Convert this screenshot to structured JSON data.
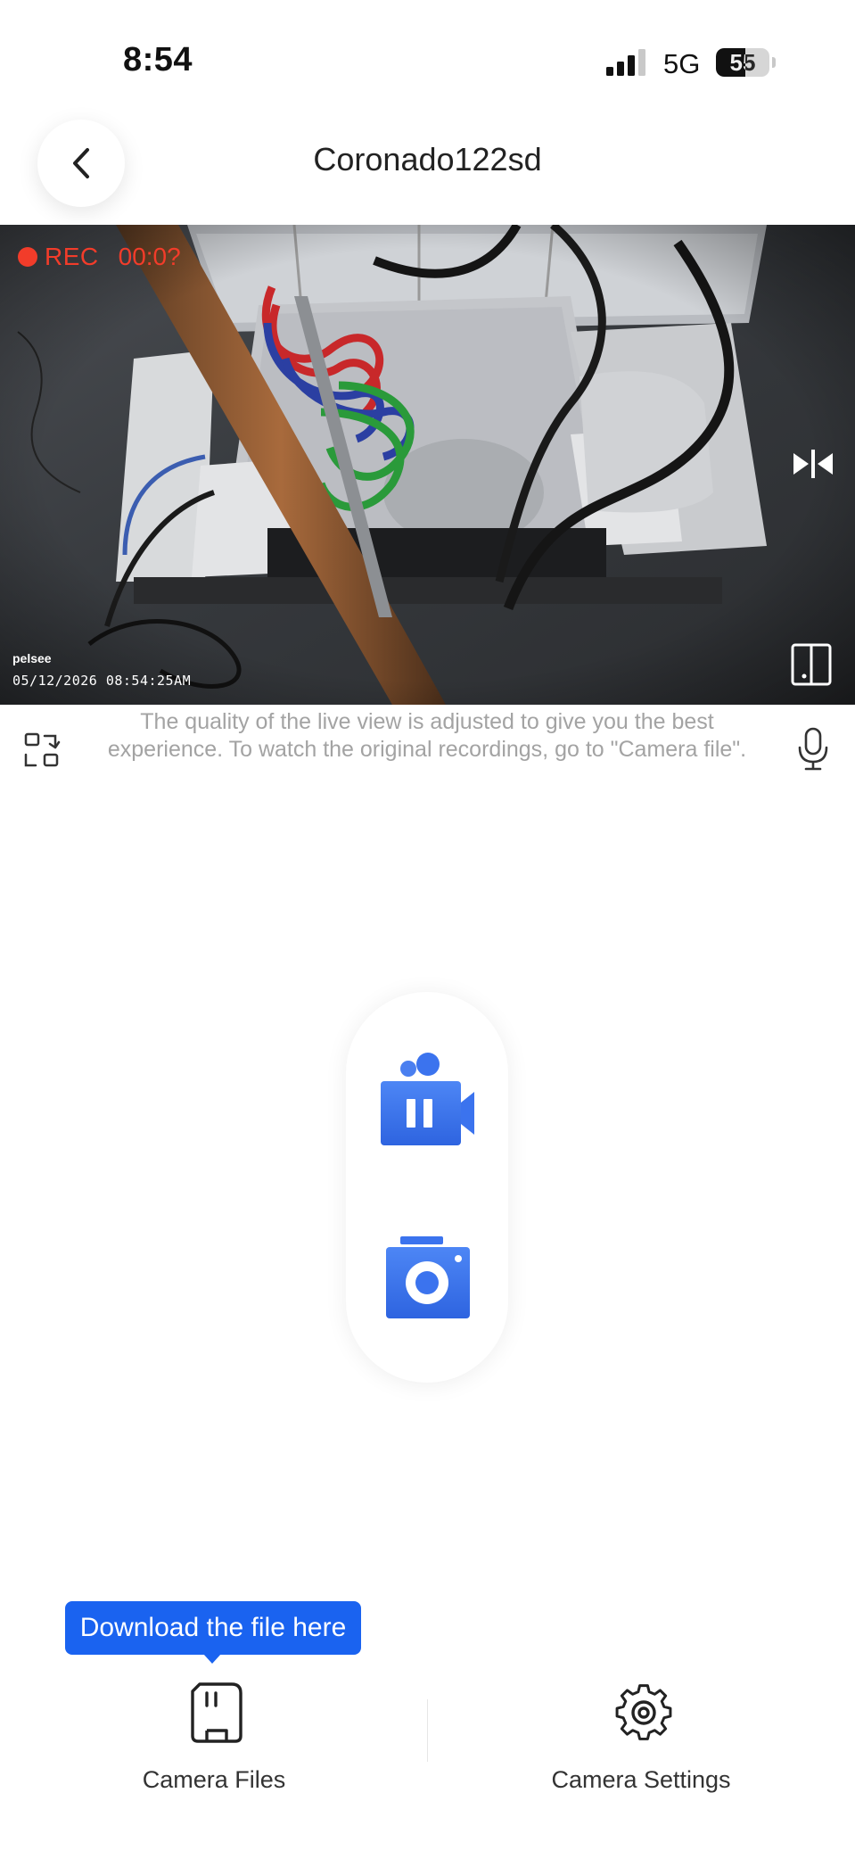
{
  "status_bar": {
    "time": "8:54",
    "network": "5G",
    "battery": "55",
    "battery_level": 0.55
  },
  "header": {
    "title": "Coronado122sd",
    "back_icon": "chevron-left-icon"
  },
  "live_view": {
    "rec_label": "REC",
    "rec_time": "00:0?",
    "brand": "pelsee",
    "timestamp": "05/12/2026 08:54:25AM",
    "mirror_icon": "mirror-flip-icon",
    "split_icon": "split-screen-icon"
  },
  "notice": {
    "text": "The quality of the live view is adjusted to give you the best experience. To watch the original recordings, go to \"Camera file\"."
  },
  "controls": {
    "rotate_icon": "rotate-view-icon",
    "mic_icon": "microphone-icon",
    "record_icon": "video-pause-icon",
    "snapshot_icon": "camera-icon",
    "accent_color": "#3b73ee"
  },
  "tooltip": {
    "text": "Download the file here",
    "color": "#1a63f0"
  },
  "bottom_nav": {
    "files_label": "Camera Files",
    "settings_label": "Camera Settings",
    "files_icon": "sd-card-icon",
    "settings_icon": "gear-icon"
  }
}
